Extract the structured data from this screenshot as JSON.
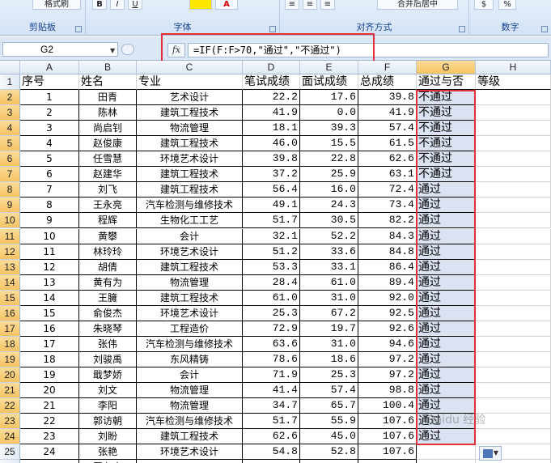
{
  "ribbon": {
    "clipboard": {
      "label": "剪贴板",
      "format_painter": "格式刷"
    },
    "font": {
      "label": "字体",
      "bold": "B",
      "italic": "I",
      "underline": "U",
      "font_color": "A"
    },
    "alignment": {
      "label": "对齐方式",
      "merge": "合并后居中"
    },
    "number": {
      "label": "数字",
      "percent": "%"
    }
  },
  "formula_bar": {
    "name_box": "G2",
    "fx": "fx",
    "formula": "=IF(F:F>70,\"通过\",\"不通过\")"
  },
  "columns": [
    "A",
    "B",
    "C",
    "D",
    "E",
    "F",
    "G",
    "H"
  ],
  "header_row": [
    "序号",
    "姓名",
    "专业",
    "笔试成绩",
    "面试成绩",
    "总成绩",
    "通过与否",
    "等级"
  ],
  "rows": [
    {
      "no": "1",
      "name": "田青",
      "major": "艺术设计",
      "written": "22.2",
      "interview": "17.6",
      "total": "39.8",
      "result": "不通过"
    },
    {
      "no": "2",
      "name": "陈林",
      "major": "建筑工程技术",
      "written": "41.9",
      "interview": "0.0",
      "total": "41.9",
      "result": "不通过"
    },
    {
      "no": "3",
      "name": "尚启钊",
      "major": "物流管理",
      "written": "18.1",
      "interview": "39.3",
      "total": "57.4",
      "result": "不通过"
    },
    {
      "no": "4",
      "name": "赵俊康",
      "major": "建筑工程技术",
      "written": "46.0",
      "interview": "15.5",
      "total": "61.5",
      "result": "不通过"
    },
    {
      "no": "5",
      "name": "任雪慧",
      "major": "环境艺术设计",
      "written": "39.8",
      "interview": "22.8",
      "total": "62.6",
      "result": "不通过"
    },
    {
      "no": "6",
      "name": "赵建华",
      "major": "建筑工程技术",
      "written": "37.2",
      "interview": "25.9",
      "total": "63.1",
      "result": "不通过"
    },
    {
      "no": "7",
      "name": "刘飞",
      "major": "建筑工程技术",
      "written": "56.4",
      "interview": "16.0",
      "total": "72.4",
      "result": "通过"
    },
    {
      "no": "8",
      "name": "王永亮",
      "major": "汽车检测与维修技术",
      "written": "49.1",
      "interview": "24.3",
      "total": "73.4",
      "result": "通过"
    },
    {
      "no": "9",
      "name": "程辉",
      "major": "生物化工工艺",
      "written": "51.7",
      "interview": "30.5",
      "total": "82.2",
      "result": "通过"
    },
    {
      "no": "10",
      "name": "黄攀",
      "major": "会计",
      "written": "32.1",
      "interview": "52.2",
      "total": "84.3",
      "result": "通过"
    },
    {
      "no": "11",
      "name": "林玲玲",
      "major": "环境艺术设计",
      "written": "51.2",
      "interview": "33.6",
      "total": "84.8",
      "result": "通过"
    },
    {
      "no": "12",
      "name": "胡倩",
      "major": "建筑工程技术",
      "written": "53.3",
      "interview": "33.1",
      "total": "86.4",
      "result": "通过"
    },
    {
      "no": "13",
      "name": "黄有为",
      "major": "物流管理",
      "written": "28.4",
      "interview": "61.0",
      "total": "89.4",
      "result": "通过"
    },
    {
      "no": "14",
      "name": "王臃",
      "major": "建筑工程技术",
      "written": "61.0",
      "interview": "31.0",
      "total": "92.0",
      "result": "通过"
    },
    {
      "no": "15",
      "name": "俞俊杰",
      "major": "环境艺术设计",
      "written": "25.3",
      "interview": "67.2",
      "total": "92.5",
      "result": "通过"
    },
    {
      "no": "16",
      "name": "朱晓琴",
      "major": "工程造价",
      "written": "72.9",
      "interview": "19.7",
      "total": "92.6",
      "result": "通过"
    },
    {
      "no": "17",
      "name": "张伟",
      "major": "汽车检测与维修技术",
      "written": "63.6",
      "interview": "31.0",
      "total": "94.6",
      "result": "通过"
    },
    {
      "no": "18",
      "name": "刘骏禹",
      "major": "东风精铸",
      "written": "78.6",
      "interview": "18.6",
      "total": "97.2",
      "result": "通过"
    },
    {
      "no": "19",
      "name": "戢梦娇",
      "major": "会计",
      "written": "71.9",
      "interview": "25.3",
      "total": "97.2",
      "result": "通过"
    },
    {
      "no": "20",
      "name": "刘文",
      "major": "物流管理",
      "written": "41.4",
      "interview": "57.4",
      "total": "98.8",
      "result": "通过"
    },
    {
      "no": "21",
      "name": "李阳",
      "major": "物流管理",
      "written": "34.7",
      "interview": "65.7",
      "total": "100.4",
      "result": "通过"
    },
    {
      "no": "22",
      "name": "郭访朝",
      "major": "汽车检测与维修技术",
      "written": "51.7",
      "interview": "55.9",
      "total": "107.6",
      "result": "通过"
    },
    {
      "no": "23",
      "name": "刘盼",
      "major": "建筑工程技术",
      "written": "62.6",
      "interview": "45.0",
      "total": "107.6",
      "result": "通过"
    },
    {
      "no": "24",
      "name": "张艳",
      "major": "环境艺术设计",
      "written": "54.8",
      "interview": "52.8",
      "total": "107.6",
      "result": ""
    },
    {
      "no": "",
      "name": "罗九宏",
      "major": "",
      "written": "",
      "interview": "",
      "total": "",
      "result": ""
    }
  ],
  "watermark": "Baidu 经验"
}
